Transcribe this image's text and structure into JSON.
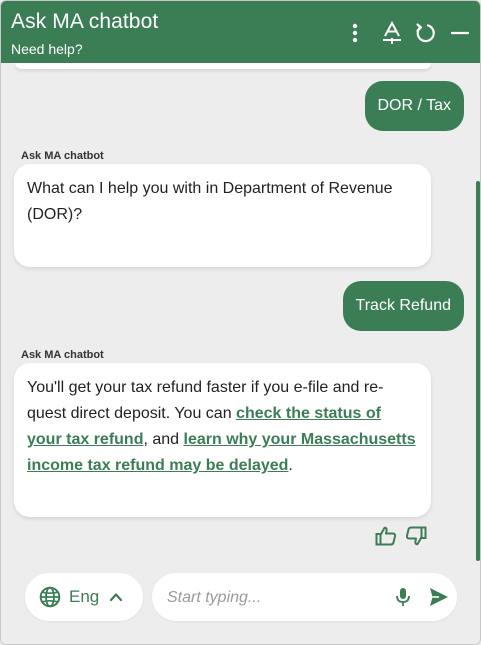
{
  "header": {
    "title": "Ask MA chatbot",
    "subtitle": "Need help?",
    "icons": [
      "more-vertical-icon",
      "text-size-icon",
      "restart-icon",
      "minimize-icon"
    ]
  },
  "messages": {
    "user_1": "DOR / Tax",
    "bot_1_label": "Ask MA chatbot",
    "bot_1_text": "What can I help you with in Department of Revenue (DOR)?",
    "user_2": "Track Refund",
    "bot_2_label": "Ask MA chatbot",
    "bot_2": {
      "intro": "You'll get your tax refund faster if you e-file and re-quest direct deposit. You can ",
      "link_1": "check the status of your tax refund",
      "middle": ", and ",
      "link_2": "learn why your Massachusetts income tax refund may be delayed",
      "end": "."
    }
  },
  "footer": {
    "language": "Eng",
    "input_placeholder": "Start typing...",
    "input_value": ""
  },
  "colors": {
    "accent": "#3b7d55",
    "background": "#ededed",
    "bubble_bot": "#ffffff"
  }
}
